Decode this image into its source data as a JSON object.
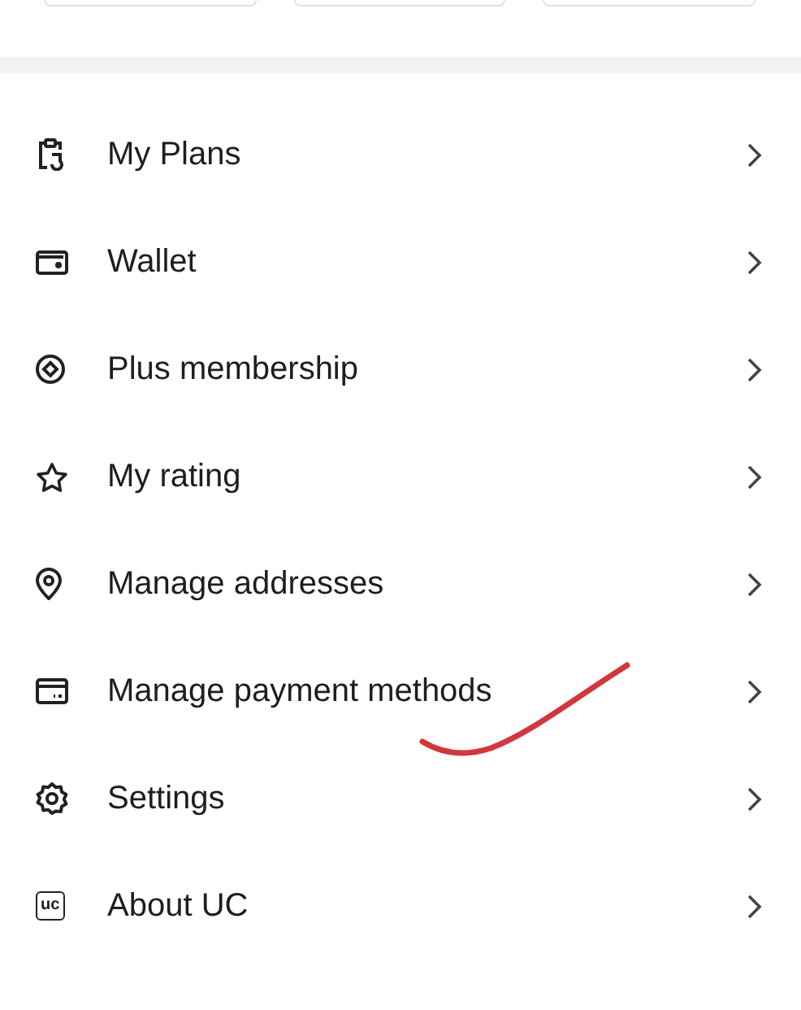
{
  "top_cards": [
    {
      "kind": "card"
    },
    {
      "kind": "card"
    },
    {
      "kind": "card"
    }
  ],
  "menu": [
    {
      "label": "My Plans",
      "kind": "plans"
    },
    {
      "label": "Wallet",
      "kind": "wallet"
    },
    {
      "label": "Plus membership",
      "kind": "plus"
    },
    {
      "label": "My rating",
      "kind": "star"
    },
    {
      "label": "Manage addresses",
      "kind": "pin"
    },
    {
      "label": "Manage payment methods",
      "kind": "card"
    },
    {
      "label": "Settings",
      "kind": "gear"
    },
    {
      "label": "About UC",
      "kind": "logo",
      "icon_text": "uc"
    }
  ],
  "annotation": {
    "kind": "scribble",
    "color": "#d0383c"
  }
}
